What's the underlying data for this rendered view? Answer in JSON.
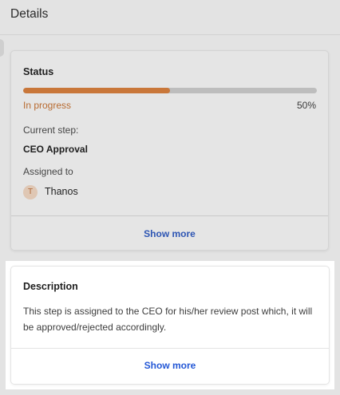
{
  "header": {
    "title": "Details"
  },
  "status_card": {
    "title": "Status",
    "progress": {
      "state_label": "In progress",
      "percent_label": "50%",
      "fraction": 0.5
    },
    "current_step_label": "Current step:",
    "current_step_value": "CEO Approval",
    "assigned_label": "Assigned to",
    "assignee": {
      "initial": "T",
      "name": "Thanos"
    },
    "show_more_label": "Show more"
  },
  "description_card": {
    "title": "Description",
    "text": "This step is assigned to the CEO for his/her review post which, it will be approved/rejected accordingly.",
    "show_more_label": "Show more"
  },
  "colors": {
    "progress_fill": "#c9773a",
    "progress_track": "#bdbdbd",
    "link": "#2458d6"
  }
}
